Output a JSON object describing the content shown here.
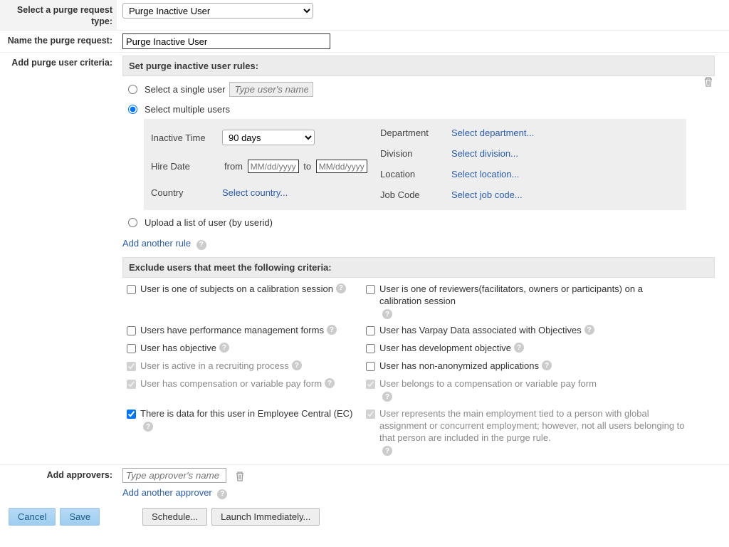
{
  "labels": {
    "purge_type": "Select a purge request type:",
    "name_request": "Name the purge request:",
    "add_criteria": "Add purge user criteria:",
    "add_approvers": "Add approvers:"
  },
  "purge_type_selected": "Purge Inactive User",
  "request_name": "Purge Inactive User",
  "rules_header": "Set purge inactive user rules:",
  "radios": {
    "single": "Select a single user",
    "single_placeholder": "Type user's name",
    "multiple": "Select multiple users",
    "upload": "Upload a list of user (by userid)"
  },
  "criteria": {
    "inactive_time_label": "Inactive Time",
    "inactive_time_value": "90 days",
    "hire_date_label": "Hire Date",
    "from": "from",
    "to": "to",
    "date_placeholder": "MM/dd/yyyy",
    "country_label": "Country",
    "country_link": "Select country...",
    "department_label": "Department",
    "department_link": "Select department...",
    "division_label": "Division",
    "division_link": "Select division...",
    "location_label": "Location",
    "location_link": "Select location...",
    "jobcode_label": "Job Code",
    "jobcode_link": "Select job code..."
  },
  "add_rule": "Add another rule",
  "exclude_header": "Exclude users that meet the following criteria:",
  "exclude": {
    "c1": "User is one of subjects on a calibration session",
    "c2": "User is one of reviewers(facilitators, owners or participants) on a calibration session",
    "c3": "Users have performance management forms",
    "c4": "User has Varpay Data associated with Objectives",
    "c5": "User has objective",
    "c6": "User has development objective",
    "c7": "User is active in a recruiting process",
    "c8": "User has non-anonymized applications",
    "c9": "User has compensation or variable pay form",
    "c10": "User belongs to a compensation or variable pay form",
    "c11": "There is data for this user in Employee Central (EC)",
    "c12": "User represents the main employment tied to a person with global assignment or concurrent employment; however, not all users belonging to that person are included in the purge rule."
  },
  "approver_placeholder": "Type approver's name",
  "add_approver": "Add another approver",
  "buttons": {
    "cancel": "Cancel",
    "save": "Save",
    "schedule": "Schedule...",
    "launch": "Launch Immediately..."
  }
}
